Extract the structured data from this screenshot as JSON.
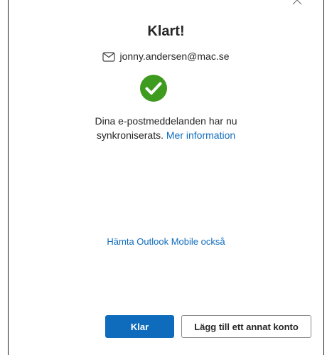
{
  "dialog": {
    "title": "Klart!",
    "account_email": "jonny.andersen@mac.se",
    "message_line1": "Dina e-postmeddelanden har nu",
    "message_line2": "synkroniserats.",
    "more_info_link": "Mer information",
    "mobile_link": "Hämta Outlook Mobile också",
    "primary_button": "Klar",
    "secondary_button": "Lägg till ett annat konto"
  },
  "icons": {
    "close": "close-icon",
    "mail": "mail-icon",
    "success": "checkmark-circle-icon"
  },
  "colors": {
    "accent": "#0f6cbd",
    "success": "#3f9b1f",
    "text": "#262626"
  }
}
